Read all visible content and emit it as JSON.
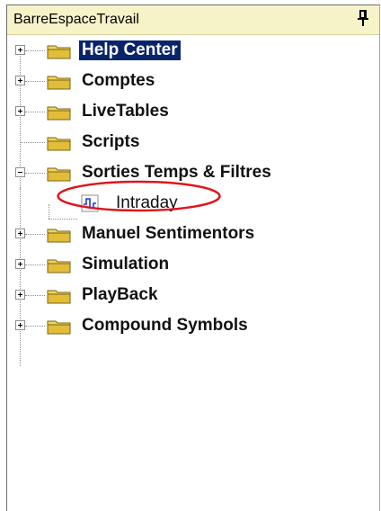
{
  "panel": {
    "title": "BarreEspaceTravail",
    "pin_icon": "pin-icon"
  },
  "tree": {
    "items": [
      {
        "label": "Help Center",
        "expander": "plus",
        "selected": true
      },
      {
        "label": "Comptes",
        "expander": "plus"
      },
      {
        "label": "LiveTables",
        "expander": "plus"
      },
      {
        "label": "Scripts",
        "expander": "none"
      },
      {
        "label": "Sorties Temps & Filtres",
        "expander": "minus"
      },
      {
        "label": "Intraday",
        "type": "leaf",
        "icon": "signal-chart-icon",
        "highlighted": true
      },
      {
        "label": "Manuel Sentimentors",
        "expander": "plus"
      },
      {
        "label": "Simulation",
        "expander": "plus"
      },
      {
        "label": "PlayBack",
        "expander": "plus"
      },
      {
        "label": "Compound Symbols",
        "expander": "plus"
      }
    ]
  },
  "colors": {
    "title_bg": "#f7f3c8",
    "selection_bg": "#0a246a",
    "annotation_red": "#e0141c",
    "folder_yellow": "#f2d35a"
  }
}
